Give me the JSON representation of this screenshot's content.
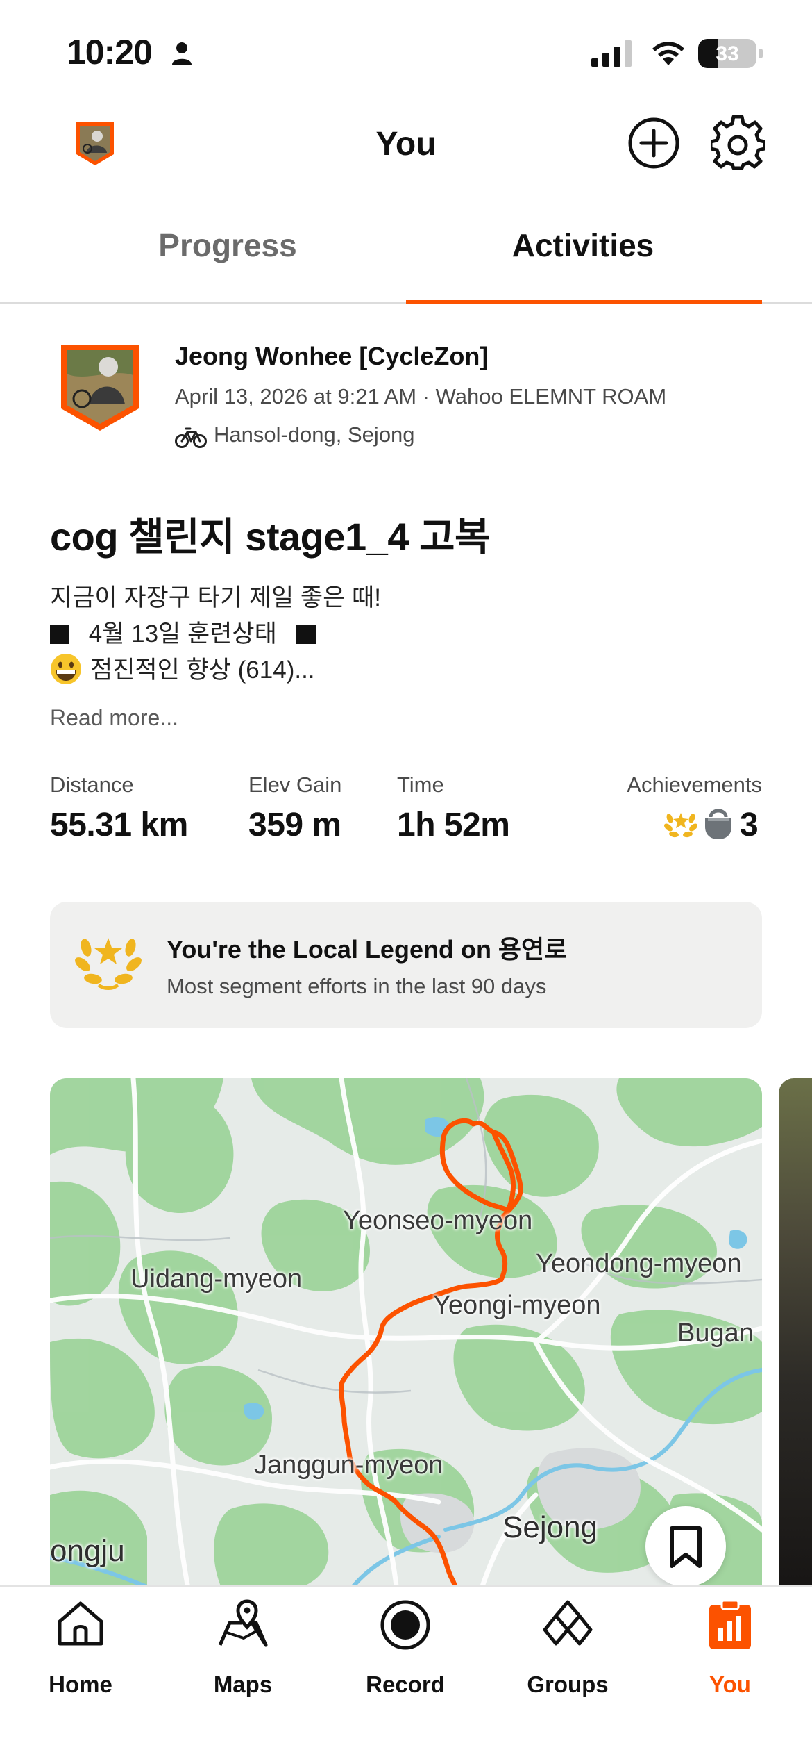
{
  "status_bar": {
    "time": "10:20",
    "battery": "33",
    "battery_level": 0.33
  },
  "header": {
    "title": "You"
  },
  "tabs": [
    {
      "label": "Progress",
      "active": false
    },
    {
      "label": "Activities",
      "active": true
    }
  ],
  "activity": {
    "athlete_name": "Jeong Wonhee  [CycleZon]",
    "meta": "April 13, 2026 at 9:21 AM · Wahoo ELEMNT ROAM",
    "location": "Hansol-dong, Sejong",
    "title": "cog 챌린지 stage1_4 고복",
    "description": {
      "line1": "지금이 자장구 타기 제일 좋은 때!",
      "line2": "4월 13일 훈련상태",
      "line3": "점진적인 향상 (614)..."
    },
    "read_more": "Read more...",
    "stats": {
      "distance_label": "Distance",
      "distance_value": "55.31 km",
      "elev_label": "Elev Gain",
      "elev_value": "359 m",
      "time_label": "Time",
      "time_value": "1h 52m",
      "achievements_label": "Achievements",
      "achievements_count": "3"
    },
    "legend": {
      "title": "You're the Local Legend on 용연로",
      "subtitle": "Most segment efforts in the last 90 days"
    },
    "map_labels": {
      "yeonseo": "Yeonseo-myeon",
      "uidang": "Uidang-myeon",
      "yeondong": "Yeondong-myeon",
      "yeongi": "Yeongi-myeon",
      "bugan": "Bugan",
      "janggun": "Janggun-myeon",
      "sejong": "Sejong",
      "gongju": "ongju"
    }
  },
  "tab_bar": [
    {
      "label": "Home",
      "icon": "home-icon",
      "active": false
    },
    {
      "label": "Maps",
      "icon": "maps-icon",
      "active": false
    },
    {
      "label": "Record",
      "icon": "record-icon",
      "active": false
    },
    {
      "label": "Groups",
      "icon": "groups-icon",
      "active": false
    },
    {
      "label": "You",
      "icon": "you-icon",
      "active": true
    }
  ],
  "colors": {
    "accent": "#fc5200",
    "route": "#fc5200",
    "legend_gold": "#f0b51f"
  }
}
